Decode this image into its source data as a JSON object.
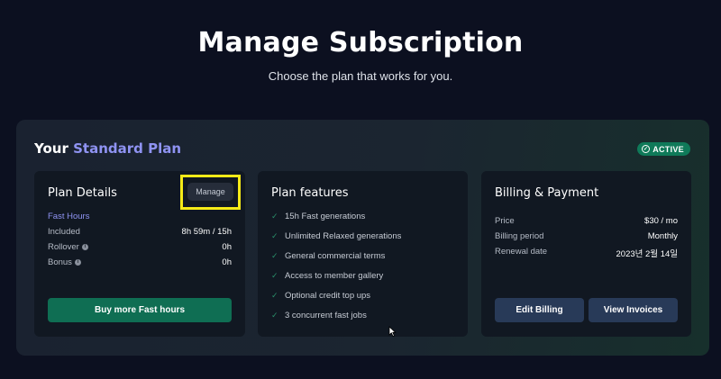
{
  "page": {
    "title": "Manage Subscription",
    "subtitle": "Choose the plan that works for you."
  },
  "plan_header": {
    "prefix": "Your",
    "plan_name": "Standard Plan",
    "status": "ACTIVE"
  },
  "plan_details": {
    "title": "Plan Details",
    "manage_label": "Manage",
    "fast_hours_label": "Fast Hours",
    "rows": [
      {
        "label": "Included",
        "value": "8h 59m / 15h"
      },
      {
        "label": "Rollover",
        "value": "0h"
      },
      {
        "label": "Bonus",
        "value": "0h"
      }
    ],
    "buy_label": "Buy more Fast hours"
  },
  "plan_features": {
    "title": "Plan features",
    "items": [
      "15h Fast generations",
      "Unlimited Relaxed generations",
      "General commercial terms",
      "Access to member gallery",
      "Optional credit top ups",
      "3 concurrent fast jobs"
    ]
  },
  "billing": {
    "title": "Billing & Payment",
    "rows": [
      {
        "label": "Price",
        "value": "$30 / mo"
      },
      {
        "label": "Billing period",
        "value": "Monthly"
      },
      {
        "label": "Renewal date",
        "value": "2023년 2월 14일"
      }
    ],
    "edit_label": "Edit Billing",
    "invoices_label": "View Invoices"
  },
  "colors": {
    "accent": "#8f93f2",
    "active_badge": "#0f7a59",
    "buy_button": "#0f6e53",
    "billing_button": "#283a58",
    "highlight": "#f5ea17"
  },
  "icons": {
    "status": "check-circle-icon",
    "info": "info-icon",
    "feature": "check-icon",
    "cursor": "mouse-cursor-icon"
  }
}
